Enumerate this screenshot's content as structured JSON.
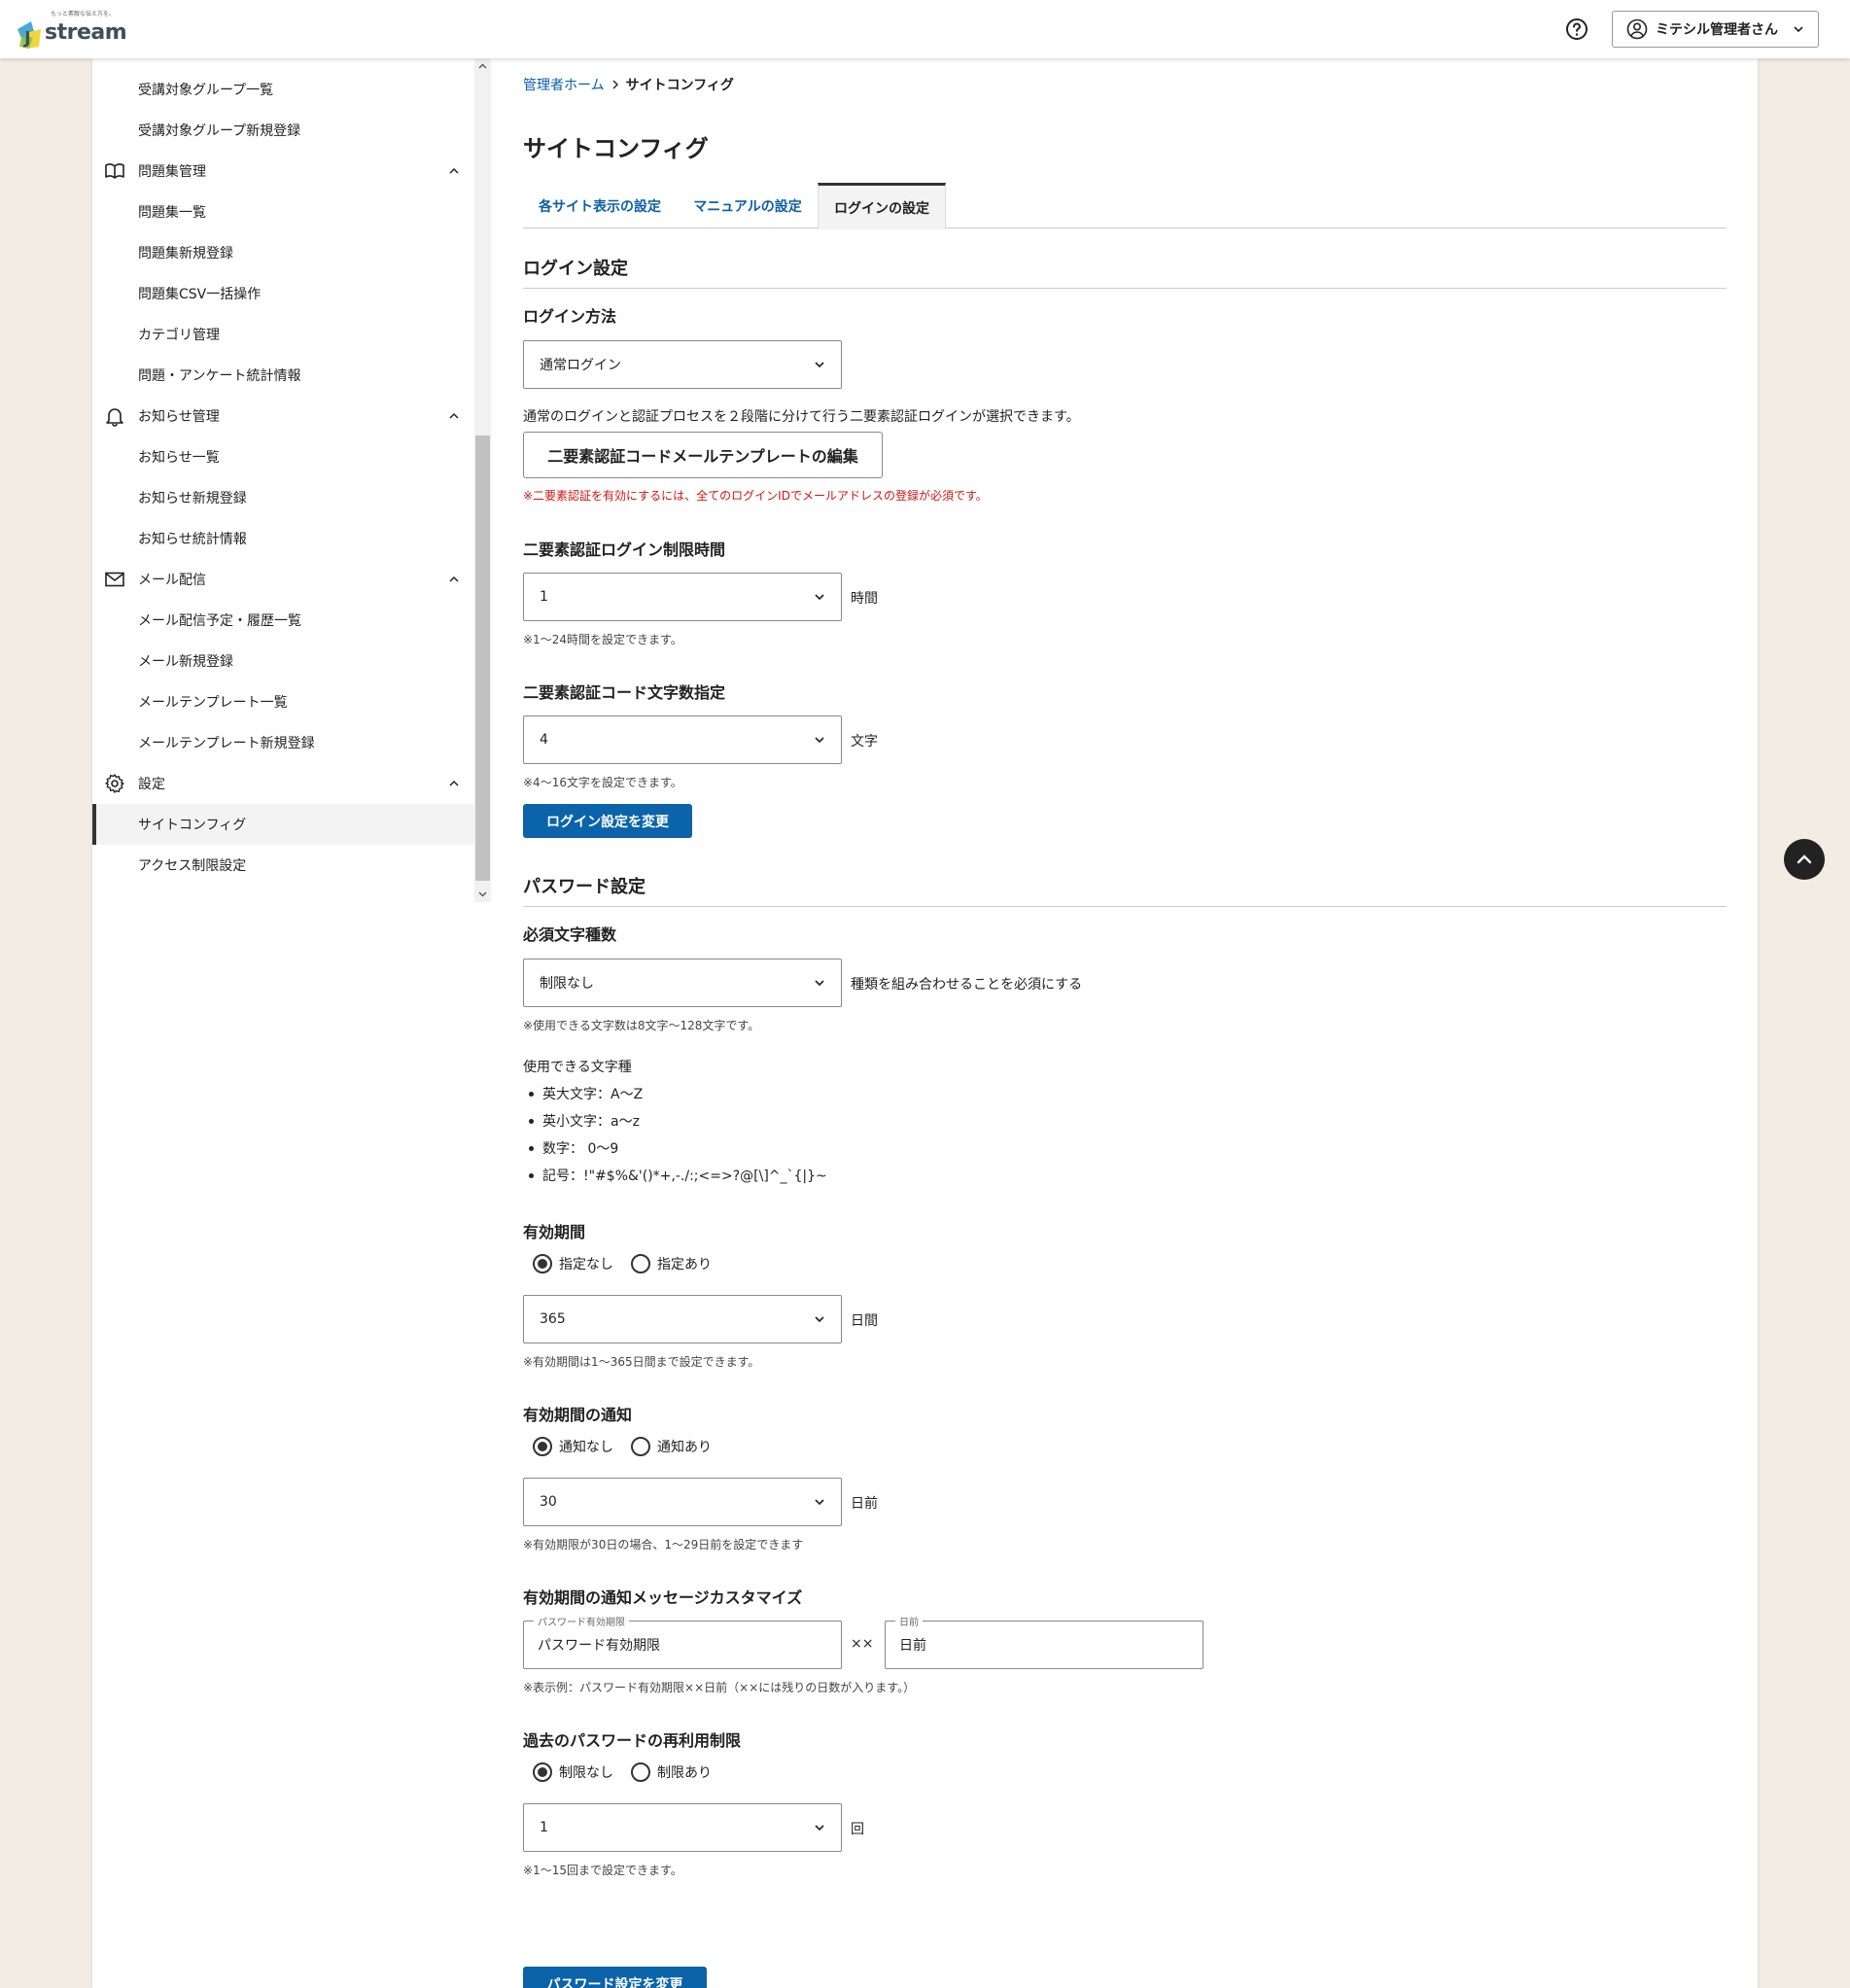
{
  "header": {
    "logo_tagline": "もっと素敵な伝え方を。",
    "logo_text": "stream",
    "logo_letter": "J",
    "user_name": "ミテシル管理者さん"
  },
  "sidebar": {
    "items": [
      {
        "type": "sub",
        "label": "受講対象グループ一覧"
      },
      {
        "type": "sub",
        "label": "受講対象グループ新規登録"
      },
      {
        "type": "group",
        "label": "問題集管理",
        "icon": "book-icon"
      },
      {
        "type": "sub",
        "label": "問題集一覧"
      },
      {
        "type": "sub",
        "label": "問題集新規登録"
      },
      {
        "type": "sub",
        "label": "問題集CSV一括操作"
      },
      {
        "type": "sub",
        "label": "カテゴリ管理"
      },
      {
        "type": "sub",
        "label": "問題・アンケート統計情報"
      },
      {
        "type": "group",
        "label": "お知らせ管理",
        "icon": "bell-icon"
      },
      {
        "type": "sub",
        "label": "お知らせ一覧"
      },
      {
        "type": "sub",
        "label": "お知らせ新規登録"
      },
      {
        "type": "sub",
        "label": "お知らせ統計情報"
      },
      {
        "type": "group",
        "label": "メール配信",
        "icon": "mail-icon"
      },
      {
        "type": "sub",
        "label": "メール配信予定・履歴一覧"
      },
      {
        "type": "sub",
        "label": "メール新規登録"
      },
      {
        "type": "sub",
        "label": "メールテンプレート一覧"
      },
      {
        "type": "sub",
        "label": "メールテンプレート新規登録"
      },
      {
        "type": "group",
        "label": "設定",
        "icon": "gear-icon"
      },
      {
        "type": "sub",
        "label": "サイトコンフィグ",
        "active": true
      },
      {
        "type": "sub",
        "label": "アクセス制限設定"
      }
    ]
  },
  "breadcrumb": {
    "home": "管理者ホーム",
    "current": "サイトコンフィグ"
  },
  "page_title": "サイトコンフィグ",
  "tabs": [
    {
      "label": "各サイト表示の設定"
    },
    {
      "label": "マニュアルの設定"
    },
    {
      "label": "ログインの設定",
      "active": true
    }
  ],
  "login": {
    "section_title": "ログイン設定",
    "method_label": "ログイン方法",
    "method_value": "通常ログイン",
    "method_desc": "通常のログインと認証プロセスを２段階に分けて行う二要素認証ログインが選択できます。",
    "template_button": "二要素認証コードメールテンプレートの編集",
    "warning": "※二要素認証を有効にするには、全てのログインIDでメールアドレスの登録が必須です。",
    "limit_label": "二要素認証ログイン制限時間",
    "limit_value": "1",
    "limit_unit": "時間",
    "limit_note": "※1〜24時間を設定できます。",
    "code_label": "二要素認証コード文字数指定",
    "code_value": "4",
    "code_unit": "文字",
    "code_note": "※4〜16文字を設定できます。",
    "submit": "ログイン設定を変更"
  },
  "password": {
    "section_title": "パスワード設定",
    "types_label": "必須文字種数",
    "types_value": "制限なし",
    "types_unit": "種類を組み合わせることを必須にする",
    "types_note": "※使用できる文字数は8文字〜128文字です。",
    "chars_heading": "使用できる文字種",
    "chars": [
      "英大文字：A〜Z",
      "英小文字：a〜z",
      "数字： 0〜9",
      "記号：!\"#$%&'()*+,-./:;<=>?@[\\]^_`{|}~"
    ],
    "expiry_label": "有効期間",
    "expiry_radio_none": "指定なし",
    "expiry_radio_set": "指定あり",
    "expiry_value": "365",
    "expiry_unit": "日間",
    "expiry_note": "※有効期間は1〜365日間まで設定できます。",
    "notify_label": "有効期間の通知",
    "notify_radio_none": "通知なし",
    "notify_radio_set": "通知あり",
    "notify_value": "30",
    "notify_unit": "日前",
    "notify_note": "※有効期限が30日の場合、1〜29日前を設定できます",
    "custom_label": "有効期間の通知メッセージカスタマイズ",
    "custom_legend1": "パスワード有効期限",
    "custom_value1": "パスワード有効期限",
    "custom_sep": "××",
    "custom_legend2": "日前",
    "custom_value2": "日前",
    "custom_note": "※表示例：パスワード有効期限××日前（××には残りの日数が入ります。）",
    "reuse_label": "過去のパスワードの再利用制限",
    "reuse_radio_none": "制限なし",
    "reuse_radio_set": "制限あり",
    "reuse_value": "1",
    "reuse_unit": "回",
    "reuse_note": "※1〜15回まで設定できます。",
    "submit": "パスワード設定を変更"
  }
}
